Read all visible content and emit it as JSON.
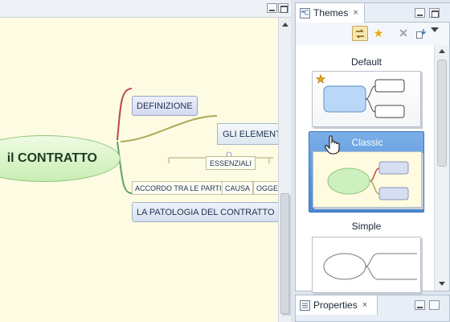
{
  "editor": {
    "map": {
      "central": "il CONTRATTO",
      "definizione": "DEFINIZIONE",
      "elementi": "GLI ELEMENTI",
      "essenziali": "ESSENZIALI",
      "accordo": "ACCORDO TRA LE PARTI",
      "causa": "CAUSA",
      "oggetto": "OGGETTO",
      "patologia": "LA PATOLOGIA DEL CONTRATTO"
    }
  },
  "themes_view": {
    "title": "Themes",
    "close_glyph": "×",
    "themes": [
      {
        "name": "Default",
        "default_marker": "star-icon"
      },
      {
        "name": "Classic",
        "selected": true
      },
      {
        "name": "Simple"
      }
    ]
  },
  "properties_view": {
    "title": "Properties",
    "close_glyph": "×"
  },
  "colors": {
    "selection": "#4a88d2",
    "canvas": "#fefbe3",
    "default_star": "#e8a90e"
  }
}
